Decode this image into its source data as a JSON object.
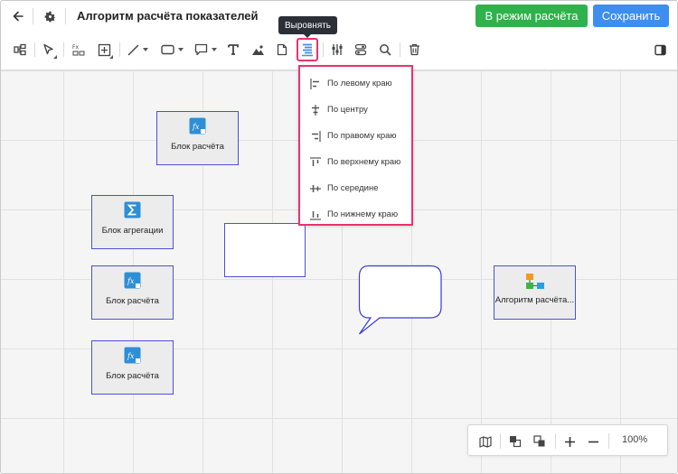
{
  "header": {
    "title": "Алгоритм расчёта показателей",
    "calc_mode_label": "В режим расчёта",
    "save_label": "Сохранить"
  },
  "toolbar": {
    "tools": [
      "hierarchy-icon",
      "pointer-icon",
      "formula-icon",
      "add-block-icon",
      "line-icon",
      "shape-rect-icon",
      "comment-icon",
      "text-icon",
      "image-icon",
      "document-icon",
      "align-icon",
      "distribute-icon",
      "group-icon",
      "search-icon",
      "delete-icon",
      "panel-toggle-icon"
    ],
    "tooltip": "Выровнять"
  },
  "align_menu": {
    "items": [
      {
        "label": "По левому краю",
        "icon": "align-left-icon"
      },
      {
        "label": "По центру",
        "icon": "align-center-icon"
      },
      {
        "label": "По правому краю",
        "icon": "align-right-icon"
      },
      {
        "label": "По верхнему краю",
        "icon": "align-top-icon"
      },
      {
        "label": "По середине",
        "icon": "align-middle-icon"
      },
      {
        "label": "По нижнему краю",
        "icon": "align-bottom-icon"
      }
    ]
  },
  "canvas": {
    "blocks": [
      {
        "label": "Блок расчёта",
        "icon": "formula-block-icon"
      },
      {
        "label": "Блок агрегации",
        "icon": "sigma-icon"
      },
      {
        "label": "Блок расчёта",
        "icon": "formula-block-icon"
      },
      {
        "label": "Блок расчёта",
        "icon": "formula-block-icon"
      },
      {
        "label": "Алгоритм расчёта...",
        "icon": "algorithm-icon"
      }
    ]
  },
  "zoom": {
    "value": "100%"
  },
  "colors": {
    "accent_green": "#2fb24c",
    "accent_blue": "#3d8ef0",
    "highlight": "#e8336d",
    "block_border": "#4e4ee0"
  }
}
